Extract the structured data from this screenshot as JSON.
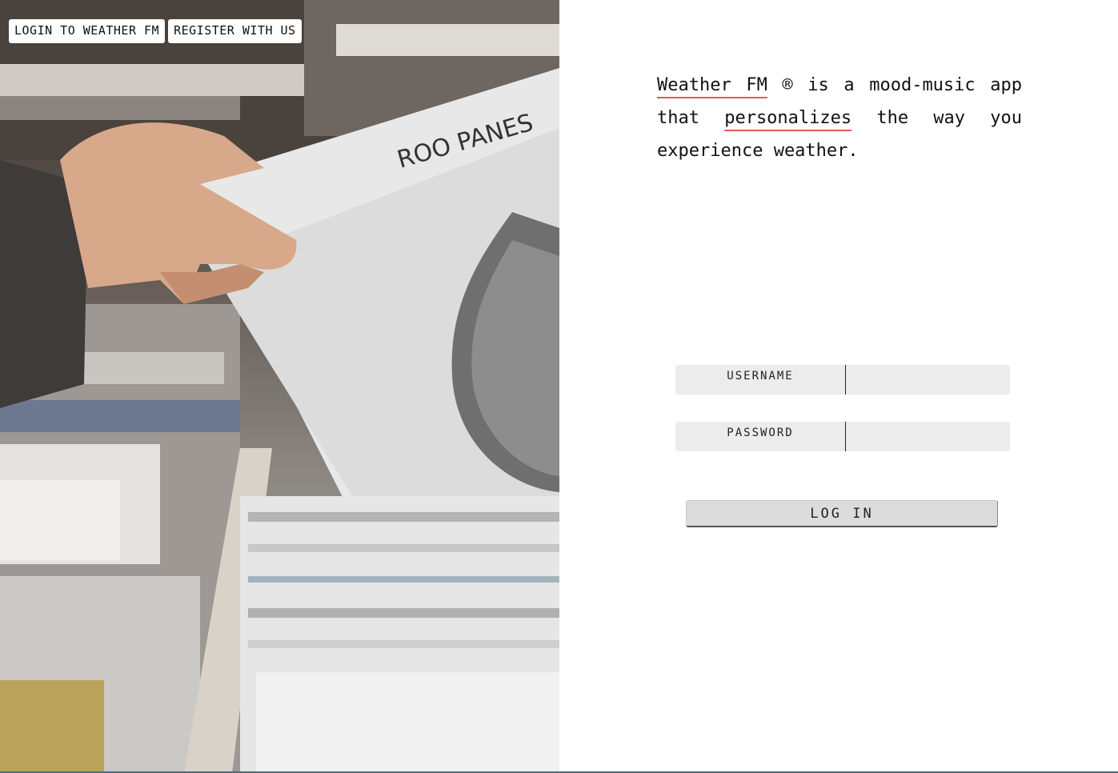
{
  "nav": {
    "login_label": "LOGIN TO WEATHER FM",
    "register_label": "REGISTER WITH US"
  },
  "hero": {
    "album_text": "ROO PANES"
  },
  "tagline": {
    "brand": "Weather FM",
    "registered_mark": "®",
    "part1": " is a mood-music app that ",
    "highlight": "personalizes",
    "part2": " the way you experience weather."
  },
  "form": {
    "username_label": "USERNAME",
    "password_label": "PASSWORD",
    "username_value": "",
    "password_value": "",
    "submit_label": "LOG IN"
  },
  "colors": {
    "accent_underline": "#e05a5a",
    "field_bg": "#ececec",
    "button_bg": "#dcdcdc"
  }
}
